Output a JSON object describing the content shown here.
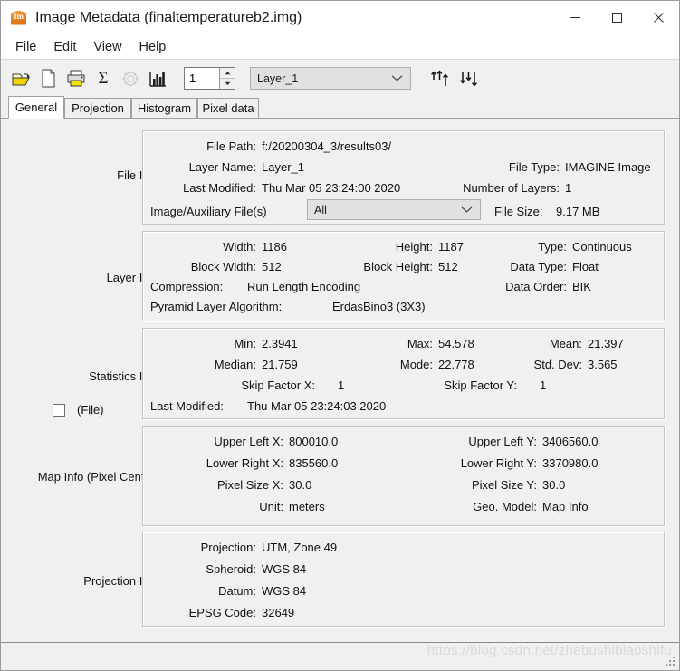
{
  "window": {
    "title": "Image Metadata (finaltemperatureb2.img)",
    "app_icon": "image-app-icon",
    "app_icon_text": "Im",
    "minimize": "—",
    "maximize": "□",
    "close": "✕"
  },
  "menubar": {
    "items": [
      "File",
      "Edit",
      "View",
      "Help"
    ]
  },
  "toolbar": {
    "icons": [
      {
        "name": "open-folder-icon",
        "label": "Open"
      },
      {
        "name": "new-file-icon",
        "label": "New"
      },
      {
        "name": "print-icon",
        "label": "Print"
      },
      {
        "name": "sigma-statistics-icon",
        "label": "Σ"
      },
      {
        "name": "pyramid-layers-icon",
        "label": "Compute Pyramid Layers"
      },
      {
        "name": "histogram-icon",
        "label": "Histogram"
      }
    ],
    "layer_spinner": {
      "value": "1",
      "up": "▲",
      "down": "▼"
    },
    "layer_combo": {
      "value": "Layer_1",
      "chevron": "chevron-down-icon"
    },
    "move_up": "⇑",
    "move_down": "⇓"
  },
  "tabs": [
    {
      "label": "General",
      "active": true
    },
    {
      "label": "Projection",
      "active": false
    },
    {
      "label": "Histogram",
      "active": false
    },
    {
      "label": "Pixel data",
      "active": false
    }
  ],
  "sections": {
    "file_info": {
      "label": "File Info:",
      "file_path_label": "File Path:",
      "file_path_value": "f:/20200304_3/results03/",
      "layer_name_label": "Layer Name:",
      "layer_name_value": "Layer_1",
      "file_type_label": "File Type:",
      "file_type_value": "IMAGINE Image",
      "last_modified_label": "Last Modified:",
      "last_modified_value": "Thu Mar 05 23:24:00 2020",
      "number_of_layers_label": "Number of Layers:",
      "number_of_layers_value": "1",
      "aux_files_label": "Image/Auxiliary File(s)",
      "aux_files_value": "All",
      "file_size_label": "File Size:",
      "file_size_value": "9.17 MB"
    },
    "layer_info": {
      "label": "Layer Info:",
      "width_label": "Width:",
      "width_value": "1186",
      "height_label": "Height:",
      "height_value": "1187",
      "type_label": "Type:",
      "type_value": "Continuous",
      "block_width_label": "Block Width:",
      "block_width_value": "512",
      "block_height_label": "Block Height:",
      "block_height_value": "512",
      "data_type_label": "Data Type:",
      "data_type_value": "Float",
      "compression_label": "Compression:",
      "compression_value": "Run Length Encoding",
      "data_order_label": "Data Order:",
      "data_order_value": "BIK",
      "pyramid_label": "Pyramid Layer Algorithm:",
      "pyramid_value": "ErdasBino3 (3X3)"
    },
    "statistics_info": {
      "label": "Statistics Info:",
      "checkbox_label": "(File)",
      "checkbox_checked": false,
      "min_label": "Min:",
      "min_value": "2.3941",
      "max_label": "Max:",
      "max_value": "54.578",
      "mean_label": "Mean:",
      "mean_value": "21.397",
      "median_label": "Median:",
      "median_value": "21.759",
      "mode_label": "Mode:",
      "mode_value": "22.778",
      "stddev_label": "Std. Dev:",
      "stddev_value": "3.565",
      "skipx_label": "Skip Factor X:",
      "skipx_value": "1",
      "skipy_label": "Skip Factor Y:",
      "skipy_value": "1",
      "last_modified_label": "Last Modified:",
      "last_modified_value": "Thu Mar 05 23:24:03 2020"
    },
    "map_info": {
      "label": "Map Info (Pixel Center):",
      "ulx_label": "Upper Left X:",
      "ulx_value": "800010.0",
      "uly_label": "Upper Left Y:",
      "uly_value": "3406560.0",
      "lrx_label": "Lower Right X:",
      "lrx_value": "835560.0",
      "lry_label": "Lower Right Y:",
      "lry_value": "3370980.0",
      "psx_label": "Pixel Size X:",
      "psx_value": "30.0",
      "psy_label": "Pixel Size Y:",
      "psy_value": "30.0",
      "unit_label": "Unit:",
      "unit_value": "meters",
      "geomodel_label": "Geo. Model:",
      "geomodel_value": "Map Info"
    },
    "projection_info": {
      "label": "Projection Info:",
      "projection_label": "Projection:",
      "projection_value": "UTM, Zone 49",
      "spheroid_label": "Spheroid:",
      "spheroid_value": "WGS 84",
      "datum_label": "Datum:",
      "datum_value": "WGS 84",
      "epsg_label": "EPSG Code:",
      "epsg_value": "32649"
    }
  },
  "watermark": "https://blog.csdn.net/zhebushibiaoshifu"
}
